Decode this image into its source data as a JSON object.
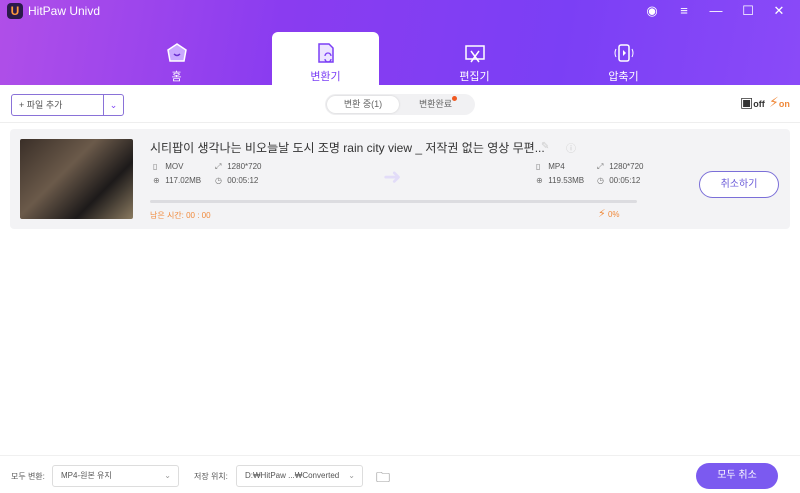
{
  "app": {
    "title": "HitPaw Univd",
    "logo": "U"
  },
  "window": {
    "account_icon": "account-icon",
    "menu_icon": "menu-icon",
    "minimize": "—",
    "maximize": "☐",
    "close": "✕"
  },
  "tabs": [
    {
      "label": "홈",
      "icon": "home-icon"
    },
    {
      "label": "변환기",
      "icon": "converter-icon"
    },
    {
      "label": "편집기",
      "icon": "editor-icon"
    },
    {
      "label": "압축기",
      "icon": "compressor-icon"
    }
  ],
  "active_tab": "변환기",
  "toolbar": {
    "add_file": "+ 파일 추가",
    "dropdown": "⌄",
    "seg_converting": "변환 중(1)",
    "seg_done": "변환완료",
    "hw_accel": "off",
    "fast_mode": "on"
  },
  "item": {
    "title": "시티팝이 생각나는 비오늘날 도시 조명 rain city view _ 저작권 없는 영상 무편...",
    "src": {
      "format": "MOV",
      "resolution": "1280*720",
      "size": "117.02MB",
      "duration": "00:05:12"
    },
    "dst": {
      "format": "MP4",
      "resolution": "1280*720",
      "size": "119.53MB",
      "duration": "00:05:12"
    },
    "progress_percent": 0,
    "remaining": "남은 시간: 00 : 00",
    "percent_label": "0%",
    "cancel": "취소하기"
  },
  "footer": {
    "convert_all_label": "모두 변환:",
    "convert_all_value": "MP4-원본 유지",
    "save_label": "저장 위치:",
    "save_value": "D:₩HitPaw ...₩Converted",
    "cancel_all": "모두 취소"
  },
  "colors": {
    "accent": "#7b3ff5",
    "orange": "#f08a3c"
  }
}
